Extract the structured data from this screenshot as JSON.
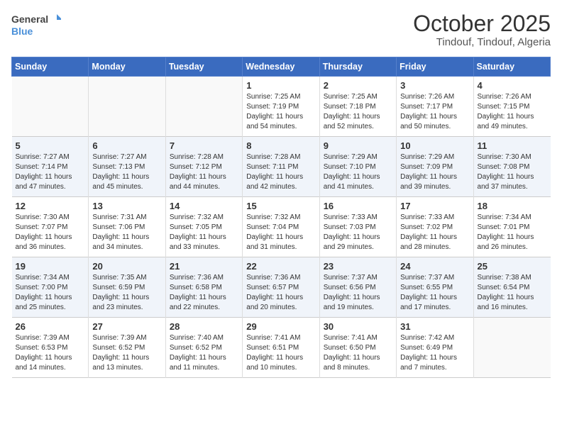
{
  "header": {
    "logo_general": "General",
    "logo_blue": "Blue",
    "month": "October 2025",
    "location": "Tindouf, Tindouf, Algeria"
  },
  "days_of_week": [
    "Sunday",
    "Monday",
    "Tuesday",
    "Wednesday",
    "Thursday",
    "Friday",
    "Saturday"
  ],
  "weeks": [
    [
      {
        "day": "",
        "info": ""
      },
      {
        "day": "",
        "info": ""
      },
      {
        "day": "",
        "info": ""
      },
      {
        "day": "1",
        "info": "Sunrise: 7:25 AM\nSunset: 7:19 PM\nDaylight: 11 hours and 54 minutes."
      },
      {
        "day": "2",
        "info": "Sunrise: 7:25 AM\nSunset: 7:18 PM\nDaylight: 11 hours and 52 minutes."
      },
      {
        "day": "3",
        "info": "Sunrise: 7:26 AM\nSunset: 7:17 PM\nDaylight: 11 hours and 50 minutes."
      },
      {
        "day": "4",
        "info": "Sunrise: 7:26 AM\nSunset: 7:15 PM\nDaylight: 11 hours and 49 minutes."
      }
    ],
    [
      {
        "day": "5",
        "info": "Sunrise: 7:27 AM\nSunset: 7:14 PM\nDaylight: 11 hours and 47 minutes."
      },
      {
        "day": "6",
        "info": "Sunrise: 7:27 AM\nSunset: 7:13 PM\nDaylight: 11 hours and 45 minutes."
      },
      {
        "day": "7",
        "info": "Sunrise: 7:28 AM\nSunset: 7:12 PM\nDaylight: 11 hours and 44 minutes."
      },
      {
        "day": "8",
        "info": "Sunrise: 7:28 AM\nSunset: 7:11 PM\nDaylight: 11 hours and 42 minutes."
      },
      {
        "day": "9",
        "info": "Sunrise: 7:29 AM\nSunset: 7:10 PM\nDaylight: 11 hours and 41 minutes."
      },
      {
        "day": "10",
        "info": "Sunrise: 7:29 AM\nSunset: 7:09 PM\nDaylight: 11 hours and 39 minutes."
      },
      {
        "day": "11",
        "info": "Sunrise: 7:30 AM\nSunset: 7:08 PM\nDaylight: 11 hours and 37 minutes."
      }
    ],
    [
      {
        "day": "12",
        "info": "Sunrise: 7:30 AM\nSunset: 7:07 PM\nDaylight: 11 hours and 36 minutes."
      },
      {
        "day": "13",
        "info": "Sunrise: 7:31 AM\nSunset: 7:06 PM\nDaylight: 11 hours and 34 minutes."
      },
      {
        "day": "14",
        "info": "Sunrise: 7:32 AM\nSunset: 7:05 PM\nDaylight: 11 hours and 33 minutes."
      },
      {
        "day": "15",
        "info": "Sunrise: 7:32 AM\nSunset: 7:04 PM\nDaylight: 11 hours and 31 minutes."
      },
      {
        "day": "16",
        "info": "Sunrise: 7:33 AM\nSunset: 7:03 PM\nDaylight: 11 hours and 29 minutes."
      },
      {
        "day": "17",
        "info": "Sunrise: 7:33 AM\nSunset: 7:02 PM\nDaylight: 11 hours and 28 minutes."
      },
      {
        "day": "18",
        "info": "Sunrise: 7:34 AM\nSunset: 7:01 PM\nDaylight: 11 hours and 26 minutes."
      }
    ],
    [
      {
        "day": "19",
        "info": "Sunrise: 7:34 AM\nSunset: 7:00 PM\nDaylight: 11 hours and 25 minutes."
      },
      {
        "day": "20",
        "info": "Sunrise: 7:35 AM\nSunset: 6:59 PM\nDaylight: 11 hours and 23 minutes."
      },
      {
        "day": "21",
        "info": "Sunrise: 7:36 AM\nSunset: 6:58 PM\nDaylight: 11 hours and 22 minutes."
      },
      {
        "day": "22",
        "info": "Sunrise: 7:36 AM\nSunset: 6:57 PM\nDaylight: 11 hours and 20 minutes."
      },
      {
        "day": "23",
        "info": "Sunrise: 7:37 AM\nSunset: 6:56 PM\nDaylight: 11 hours and 19 minutes."
      },
      {
        "day": "24",
        "info": "Sunrise: 7:37 AM\nSunset: 6:55 PM\nDaylight: 11 hours and 17 minutes."
      },
      {
        "day": "25",
        "info": "Sunrise: 7:38 AM\nSunset: 6:54 PM\nDaylight: 11 hours and 16 minutes."
      }
    ],
    [
      {
        "day": "26",
        "info": "Sunrise: 7:39 AM\nSunset: 6:53 PM\nDaylight: 11 hours and 14 minutes."
      },
      {
        "day": "27",
        "info": "Sunrise: 7:39 AM\nSunset: 6:52 PM\nDaylight: 11 hours and 13 minutes."
      },
      {
        "day": "28",
        "info": "Sunrise: 7:40 AM\nSunset: 6:52 PM\nDaylight: 11 hours and 11 minutes."
      },
      {
        "day": "29",
        "info": "Sunrise: 7:41 AM\nSunset: 6:51 PM\nDaylight: 11 hours and 10 minutes."
      },
      {
        "day": "30",
        "info": "Sunrise: 7:41 AM\nSunset: 6:50 PM\nDaylight: 11 hours and 8 minutes."
      },
      {
        "day": "31",
        "info": "Sunrise: 7:42 AM\nSunset: 6:49 PM\nDaylight: 11 hours and 7 minutes."
      },
      {
        "day": "",
        "info": ""
      }
    ]
  ]
}
